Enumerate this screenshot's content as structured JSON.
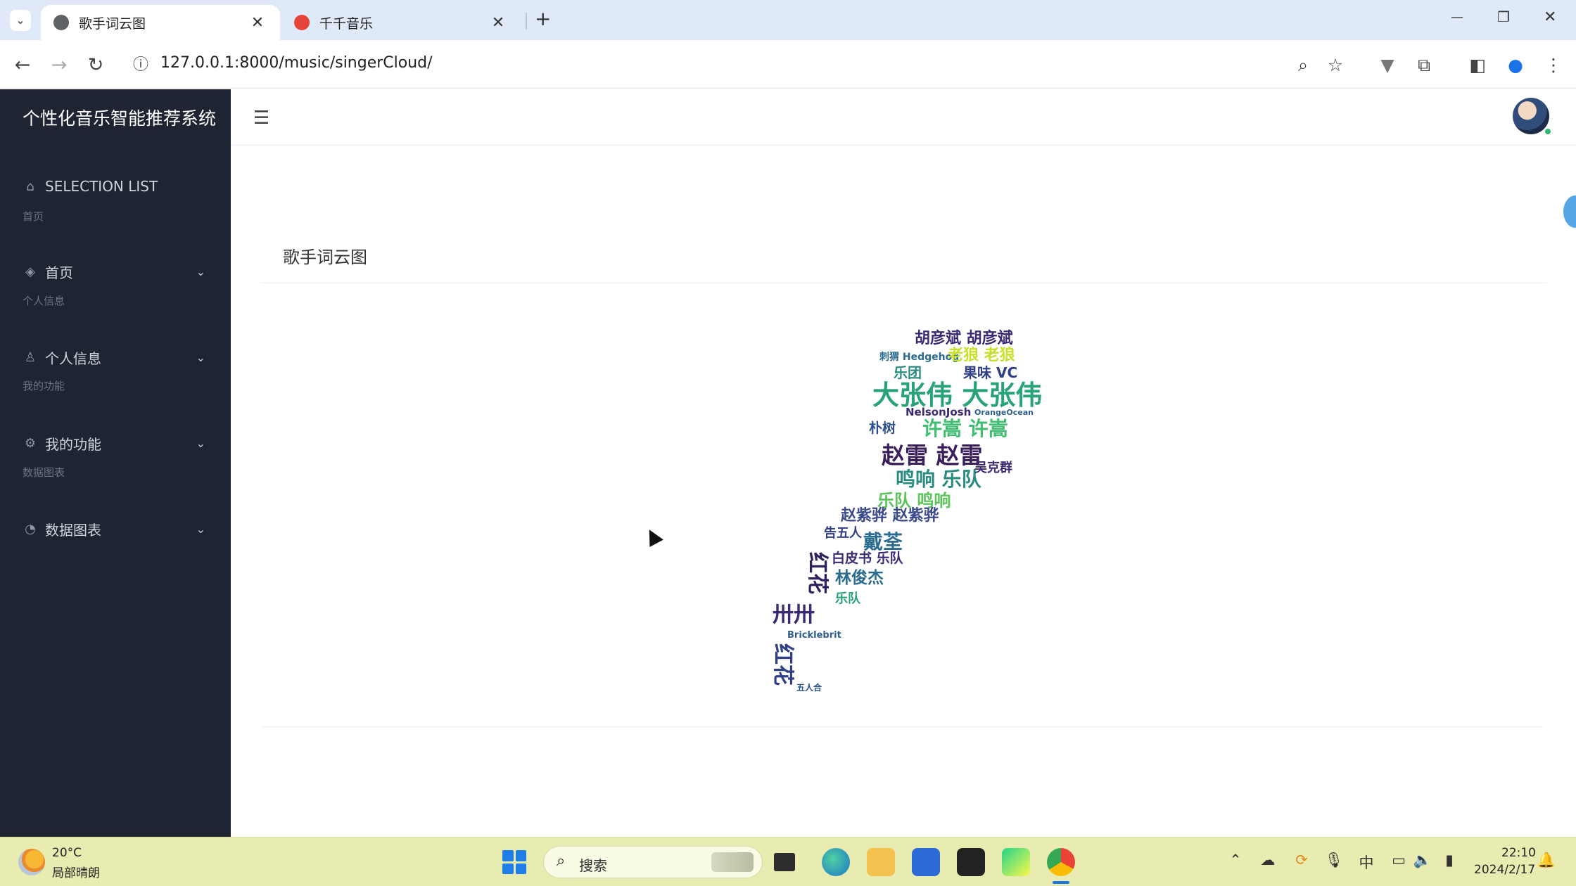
{
  "browser": {
    "tabs": [
      {
        "title": "歌手词云图",
        "active": true
      },
      {
        "title": "千千音乐",
        "active": false
      }
    ],
    "close_glyph": "✕",
    "new_tab_glyph": "+",
    "url": "127.0.0.1:8000/music/singerCloud/",
    "window_controls": {
      "minimize": "—",
      "restore": "❐",
      "close": "✕"
    }
  },
  "sidebar": {
    "brand": "个性化音乐智能推荐系统",
    "top_item": {
      "label": "SELECTION LIST",
      "icon": "home-icon"
    },
    "sections": [
      {
        "label": "首页",
        "item": {
          "label": "首页",
          "icon": "layers-icon"
        }
      },
      {
        "label": "个人信息",
        "item": {
          "label": "个人信息",
          "icon": "user-icon"
        }
      },
      {
        "label": "我的功能",
        "item": {
          "label": "我的功能",
          "icon": "settings-icon"
        }
      },
      {
        "label": "数据图表",
        "item": {
          "label": "数据图表",
          "icon": "pie-chart-icon"
        }
      }
    ]
  },
  "main": {
    "card_title": "歌手词云图",
    "word_cloud": [
      {
        "text": "胡彦斌 胡彦斌",
        "color": "#3b2a73"
      },
      {
        "text": "刺猬 Hedgehog",
        "color": "#2a6b8f"
      },
      {
        "text": "老狼 老狼",
        "color": "#c9df2b"
      },
      {
        "text": "乐团",
        "color": "#2a8c80"
      },
      {
        "text": "果味 VC",
        "color": "#2f3f86"
      },
      {
        "text": "大张伟 大张伟",
        "color": "#27a27a"
      },
      {
        "text": "NelsonJosh",
        "color": "#3b2a73"
      },
      {
        "text": "OrangeOcean",
        "color": "#2f5f8a"
      },
      {
        "text": "朴树",
        "color": "#2a4f8a"
      },
      {
        "text": "许嵩 许嵩",
        "color": "#3fbf6f"
      },
      {
        "text": "赵雷 赵雷",
        "color": "#3b1f5c"
      },
      {
        "text": "鸣响 乐队",
        "color": "#2a8c80"
      },
      {
        "text": "吴克群",
        "color": "#3b2a73"
      },
      {
        "text": "乐队 鸣响",
        "color": "#5cc35a"
      },
      {
        "text": "赵紫骅 赵紫骅",
        "color": "#3b4a8a"
      },
      {
        "text": "告五人",
        "color": "#2f3f86"
      },
      {
        "text": "戴荃",
        "color": "#2a6b8f"
      },
      {
        "text": "白皮书 乐队",
        "color": "#3b2a73"
      },
      {
        "text": "红花",
        "color": "#2f1f5c"
      },
      {
        "text": "林俊杰",
        "color": "#2a6b8f"
      },
      {
        "text": "乐队",
        "color": "#27a27a"
      },
      {
        "text": "卅卅",
        "color": "#3b2a73"
      },
      {
        "text": "Bricklebrit",
        "color": "#2f5f8a"
      },
      {
        "text": "红花",
        "color": "#2f3f86"
      },
      {
        "text": "五人合",
        "color": "#2a4f8a"
      }
    ]
  },
  "taskbar": {
    "weather_temp": "20°C",
    "weather_desc": "局部晴朗",
    "search_placeholder": "搜索",
    "ime_label": "中",
    "clock_time": "22:10",
    "clock_date": "2024/2/17"
  }
}
